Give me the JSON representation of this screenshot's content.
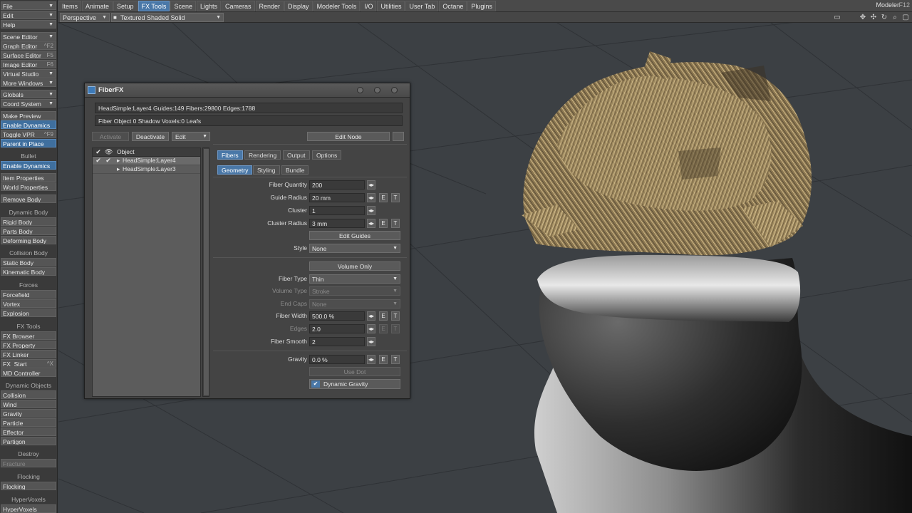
{
  "top_tabs": [
    "Items",
    "Animate",
    "Setup",
    "FX Tools",
    "Scene",
    "Lights",
    "Cameras",
    "Render",
    "Display",
    "Modeler Tools",
    "I/O",
    "Utilities",
    "User Tab",
    "Octane",
    "Plugins"
  ],
  "active_tab": "FX Tools",
  "modeler": {
    "label": "Modeler",
    "shortcut": "F12"
  },
  "viewport": {
    "view_mode": "Perspective",
    "shading_mode": "Textured Shaded Solid"
  },
  "left_menu": {
    "file": "File",
    "edit": "Edit",
    "help": "Help",
    "scene_editor": "Scene Editor",
    "graph_editor": "Graph Editor",
    "graph_editor_sc": "^F2",
    "surface_editor": "Surface Editor",
    "surface_editor_sc": "F5",
    "image_editor": "Image Editor",
    "image_editor_sc": "F6",
    "virtual_studio": "Virtual Studio",
    "more_windows": "More Windows",
    "globals": "Globals",
    "coord_system": "Coord System",
    "make_preview": "Make Preview",
    "enable_dynamics": "Enable Dynamics",
    "toggle_vpr": "Toggle VPR",
    "toggle_vpr_sc": "^F9",
    "parent_in_place": "Parent in Place",
    "bullet_header": "Bullet",
    "bullet_enable_dynamics": "Enable Dynamics",
    "item_properties": "Item Properties",
    "world_properties": "World Properties",
    "remove_body": "Remove Body",
    "dynamic_body_header": "Dynamic Body",
    "rigid_body": "Rigid Body",
    "parts_body": "Parts Body",
    "deforming_body": "Deforming Body",
    "collision_body_header": "Collision Body",
    "static_body": "Static Body",
    "kinematic_body": "Kinematic Body",
    "forces_header": "Forces",
    "forcefield": "Forcefield",
    "vortex": "Vortex",
    "explosion": "Explosion",
    "fx_tools_header": "FX Tools",
    "fx_browser": "FX Browser",
    "fx_property": "FX Property",
    "fx_linker": "FX Linker",
    "fx_start": "FX_Start",
    "fx_start_sc": "^X",
    "md_controller": "MD Controller",
    "dynamic_objects_header": "Dynamic Objects",
    "collision": "Collision",
    "wind": "Wind",
    "gravity": "Gravity",
    "particle": "Particle",
    "effector": "Effector",
    "partigon": "Partigon",
    "destroy_header": "Destroy",
    "fracture": "Fracture",
    "flocking_header": "Flocking",
    "flocking": "Flocking",
    "hypervoxels_header": "HyperVoxels",
    "hypervoxels": "HyperVoxels"
  },
  "fiberfx": {
    "title": "FiberFX",
    "info_line1": "HeadSimple:Layer4 Guides:149 Fibers:29800 Edges:1788",
    "info_line2": "Fiber Object 0 Shadow Voxels:0 Leafs",
    "activate": "Activate",
    "deactivate": "Deactivate",
    "edit": "Edit",
    "edit_node": "Edit Node",
    "object_list": {
      "header": "Object",
      "rows": [
        {
          "name": "HeadSimple:Layer4",
          "checked": true,
          "visible": true,
          "selected": true
        },
        {
          "name": "HeadSimple:Layer3",
          "checked": false,
          "visible": false,
          "selected": false
        }
      ]
    },
    "tabs": [
      "Fibers",
      "Rendering",
      "Output",
      "Options"
    ],
    "active_tab": "Fibers",
    "subtabs": [
      "Geometry",
      "Styling",
      "Bundle"
    ],
    "active_subtab": "Geometry",
    "fiber_quantity": {
      "label": "Fiber Quantity",
      "value": "200"
    },
    "guide_radius": {
      "label": "Guide Radius",
      "value": "20 mm"
    },
    "cluster": {
      "label": "Cluster",
      "value": "1"
    },
    "cluster_radius": {
      "label": "Cluster Radius",
      "value": "3 mm"
    },
    "edit_guides": "Edit Guides",
    "style": {
      "label": "Style",
      "value": "None"
    },
    "volume_only": "Volume Only",
    "fiber_type": {
      "label": "Fiber Type",
      "value": "Thin"
    },
    "volume_type": {
      "label": "Volume Type",
      "value": "Stroke"
    },
    "end_caps": {
      "label": "End Caps",
      "value": "None"
    },
    "fiber_width": {
      "label": "Fiber Width",
      "value": "500.0 %"
    },
    "edges": {
      "label": "Edges",
      "value": "2.0"
    },
    "fiber_smooth": {
      "label": "Fiber Smooth",
      "value": "2"
    },
    "gravity": {
      "label": "Gravity",
      "value": "0.0 %"
    },
    "use_dot": "Use Dot",
    "dynamic_gravity": "Dynamic Gravity",
    "env_e": "E",
    "env_t": "T"
  },
  "colors": {
    "accent": "#4a78a8",
    "panel": "#444444",
    "viewport": "#3c4044",
    "hair": "#c9b07e"
  }
}
